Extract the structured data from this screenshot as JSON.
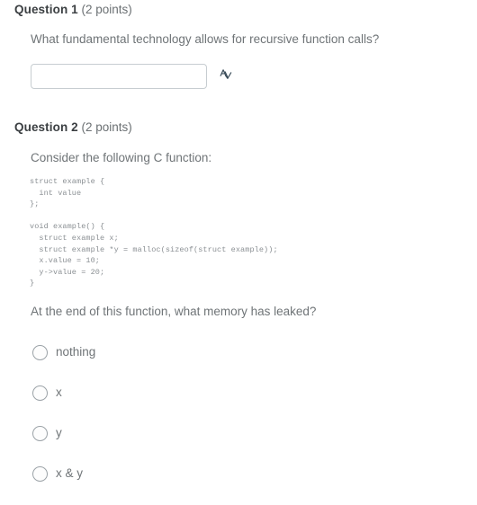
{
  "page": {
    "type": "quiz",
    "background_color": "#ffffff",
    "text_color": "#6f7477",
    "heading_color": "#3b3f42",
    "border_color": "#c7cdd1"
  },
  "questions": [
    {
      "name": "Question 1",
      "points": "(2 points)",
      "prompt": "What fundamental technology allows for recursive function calls?",
      "answer_type": "short-answer",
      "input": {
        "value": "",
        "placeholder": ""
      },
      "spellcheck_icon": "spellcheck-icon"
    },
    {
      "name": "Question 2",
      "points": "(2 points)",
      "prompt": "Consider the following C function:",
      "code": "struct example {\n  int value\n};\n\nvoid example() {\n  struct example x;\n  struct example *y = malloc(sizeof(struct example));\n  x.value = 10;\n  y->value = 20;\n}",
      "follow_up": "At the end of this function, what memory has leaked?",
      "answer_type": "multiple-choice",
      "selected": null,
      "options": [
        {
          "label": "nothing",
          "selected": false
        },
        {
          "label": "x",
          "selected": false
        },
        {
          "label": "y",
          "selected": false
        },
        {
          "label": "x & y",
          "selected": false
        }
      ]
    }
  ]
}
